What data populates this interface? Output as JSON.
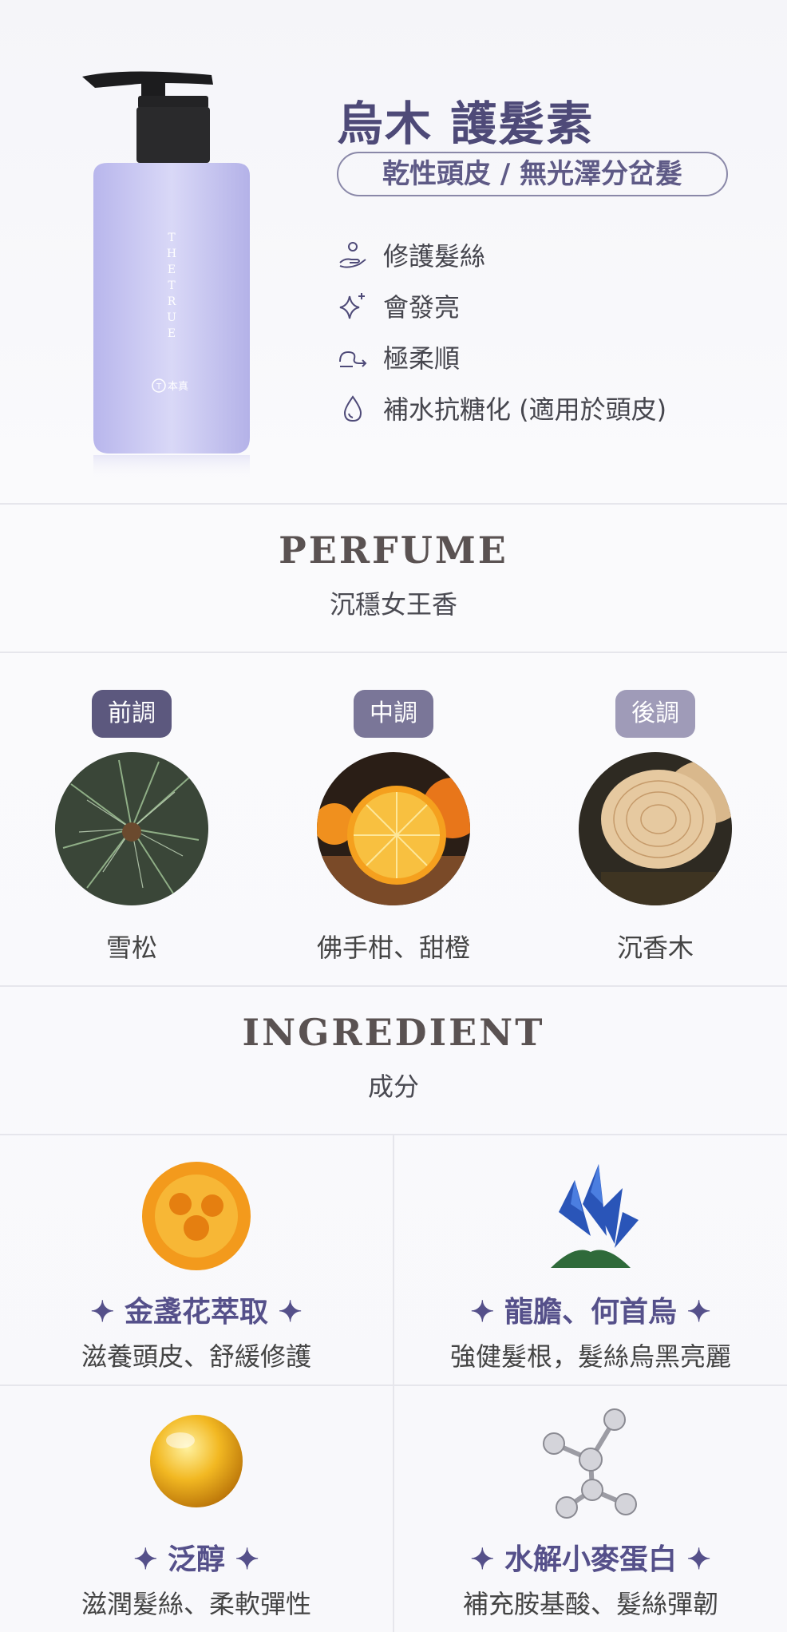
{
  "product": {
    "title": "烏木 護髮素",
    "hair_type": "乾性頭皮 / 無光澤分岔髮",
    "bottle_brand_vertical": "THETRUE",
    "bottle_brand_cn": "本真",
    "features": [
      {
        "icon": "hand-icon",
        "label": "修護髮絲"
      },
      {
        "icon": "sparkle-icon",
        "label": "會發亮"
      },
      {
        "icon": "wave-arrow-icon",
        "label": "極柔順"
      },
      {
        "icon": "drop-icon",
        "label": "補水抗糖化 (適用於頭皮)"
      }
    ]
  },
  "perfume": {
    "title": "PERFUME",
    "subtitle": "沉穩女王香",
    "notes": [
      {
        "badge": "前調",
        "badge_color": "#5c587e",
        "label": "雪松",
        "image": "pine-image"
      },
      {
        "badge": "中調",
        "badge_color": "#7a7698",
        "label": "佛手柑、甜橙",
        "image": "orange-image"
      },
      {
        "badge": "後調",
        "badge_color": "#9f9bb8",
        "label": "沉香木",
        "image": "wood-image"
      }
    ]
  },
  "ingredient": {
    "title": "INGREDIENT",
    "subtitle": "成分",
    "items": [
      {
        "name": "金盞花萃取",
        "desc": "滋養頭皮、舒緩修護",
        "image": "marigold-image"
      },
      {
        "name": "龍膽、何首烏",
        "desc": "強健髮根，髮絲烏黑亮麗",
        "image": "gentian-image"
      },
      {
        "name": "泛醇",
        "desc": "滋潤髮絲、柔軟彈性",
        "image": "panthenol-image"
      },
      {
        "name": "水解小麥蛋白",
        "desc": "補充胺基酸、髮絲彈韌",
        "image": "molecule-image"
      }
    ],
    "star": "✦"
  },
  "colors": {
    "accent": "#4e4a78",
    "bottle": "#c9c8f0"
  }
}
